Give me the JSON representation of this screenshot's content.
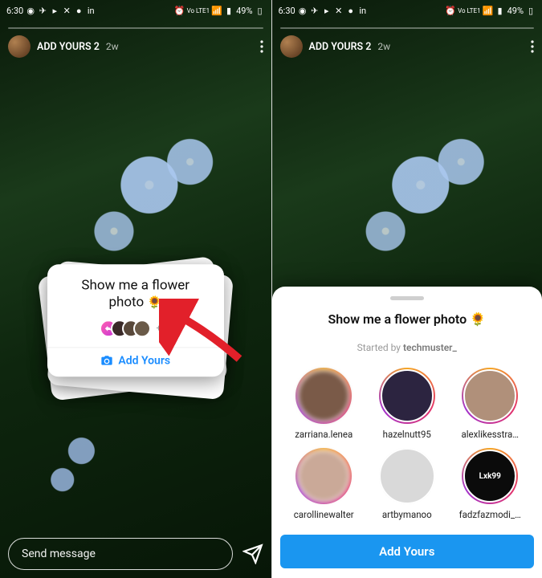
{
  "status": {
    "time": "6:30",
    "net_label": "Vo LTE1",
    "battery": "49%"
  },
  "story": {
    "username": "ADD YOURS 2",
    "age": "2w"
  },
  "prompt": {
    "text_line1": "Show me a flower",
    "text_line2": "photo",
    "emoji": "🌻",
    "full": "Show me a flower photo 🌻"
  },
  "sticker": {
    "more_count": "+18",
    "cta": "Add Yours"
  },
  "reply": {
    "placeholder": "Send message"
  },
  "sheet": {
    "started_prefix": "Started by",
    "started_user": "techmuster_",
    "cta": "Add Yours",
    "participants": [
      {
        "name": "zarriana.lenea",
        "blur": true,
        "bg": "#7a5a48"
      },
      {
        "name": "hazelnutt95",
        "blur": false,
        "bg": "#2c2440"
      },
      {
        "name": "alexlikesstra…",
        "blur": false,
        "bg": "#b0907a"
      },
      {
        "name": "carollinewalter",
        "blur": true,
        "bg": "#caa998"
      },
      {
        "name": "artbymanoo",
        "blur": false,
        "bg": "#d9d9d9",
        "nograd": true
      },
      {
        "name": "fadzfazmodi_…",
        "blur": false,
        "bg": "#0b0b0b",
        "label": "Lxk99"
      }
    ]
  }
}
